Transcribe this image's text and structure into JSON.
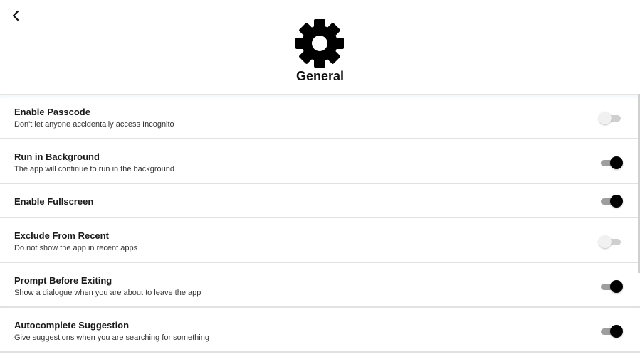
{
  "header": {
    "title": "General",
    "back_icon": "chevron-left-icon",
    "header_icon": "gear-icon"
  },
  "colors": {
    "toggle_on_thumb": "#000000",
    "toggle_on_track": "#9e9e9e",
    "toggle_off_thumb": "#f1f1f1",
    "toggle_off_track": "#cfcfcf"
  },
  "settings": [
    {
      "title": "Enable Passcode",
      "subtitle": "Don't let anyone accidentally access Incognito",
      "enabled": false
    },
    {
      "title": "Run in Background",
      "subtitle": "The app will continue to run in the background",
      "enabled": true
    },
    {
      "title": "Enable Fullscreen",
      "subtitle": "",
      "enabled": true
    },
    {
      "title": "Exclude From Recent",
      "subtitle": "Do not show the app in recent apps",
      "enabled": false
    },
    {
      "title": "Prompt Before Exiting",
      "subtitle": "Show a dialogue when you are about to leave the app",
      "enabled": true
    },
    {
      "title": "Autocomplete Suggestion",
      "subtitle": "Give suggestions when you are searching for something",
      "enabled": true
    }
  ]
}
